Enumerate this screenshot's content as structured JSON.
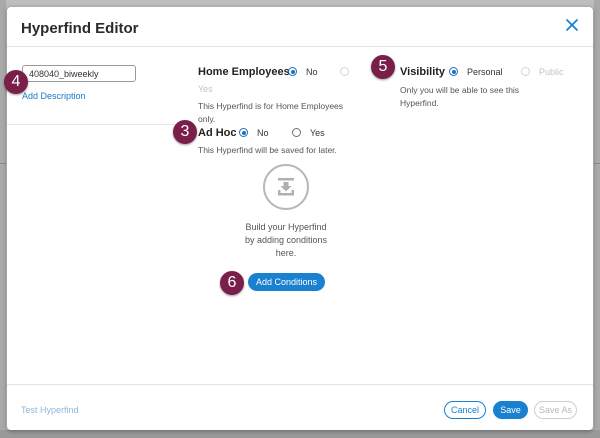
{
  "dialog": {
    "title": "Hyperfind Editor"
  },
  "name_field": {
    "value": "408040_biweekly",
    "add_description_label": "Add Description"
  },
  "callouts": {
    "ad_hoc": "3",
    "name": "4",
    "visibility": "5",
    "add_conditions": "6"
  },
  "home_employees": {
    "label": "Home Employees",
    "option_no": "No",
    "option_yes": "Yes",
    "selected": "No",
    "help_line1": "This Hyperfind is for Home Employees",
    "help_line2": "only."
  },
  "ad_hoc": {
    "label": "Ad Hoc",
    "option_no": "No",
    "option_yes": "Yes",
    "selected": "No",
    "help": "This Hyperfind will be saved for later."
  },
  "visibility": {
    "label": "Visibility",
    "option_personal": "Personal",
    "option_public": "Public",
    "selected": "Personal",
    "help_line1": "Only you will be able to see this",
    "help_line2": "Hyperfind."
  },
  "empty_state": {
    "icon": "download-tray-icon",
    "line1": "Build your Hyperfind",
    "line2": "by adding conditions",
    "line3": "here.",
    "button_label": "Add Conditions"
  },
  "footer": {
    "test_label": "Test Hyperfind",
    "cancel_label": "Cancel",
    "save_label": "Save",
    "save_as_label": "Save As"
  },
  "colors": {
    "accent": "#1a80d0",
    "callout": "#7a1f4a",
    "link": "#1b78c8"
  }
}
